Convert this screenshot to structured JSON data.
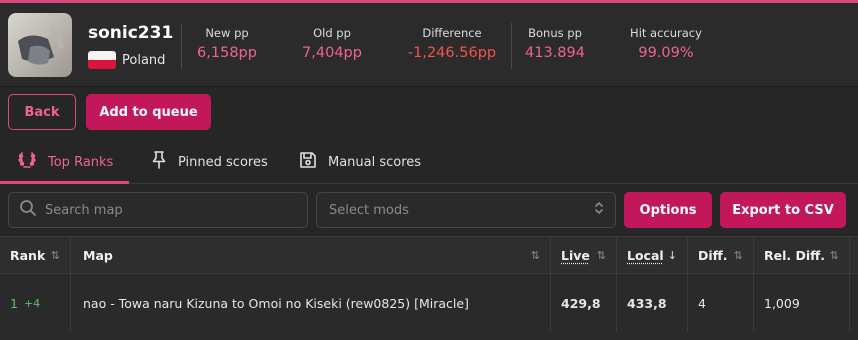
{
  "user": {
    "name": "sonic231",
    "country": "Poland"
  },
  "stats": [
    {
      "label": "New pp",
      "value": "6,158pp"
    },
    {
      "label": "Old pp",
      "value": "7,404pp"
    },
    {
      "label": "Difference",
      "value": "-1,246.56pp"
    },
    {
      "label": "Bonus pp",
      "value": "413.894"
    },
    {
      "label": "Hit accuracy",
      "value": "99.09%"
    }
  ],
  "actions": {
    "back": "Back",
    "add_to_queue": "Add to queue"
  },
  "tabs": [
    {
      "label": "Top Ranks",
      "icon": "laurel-icon",
      "active": true
    },
    {
      "label": "Pinned scores",
      "icon": "pin-icon",
      "active": false
    },
    {
      "label": "Manual scores",
      "icon": "save-icon",
      "active": false
    }
  ],
  "filters": {
    "search_placeholder": "Search map",
    "mods_placeholder": "Select mods",
    "options": "Options",
    "export": "Export to CSV"
  },
  "table": {
    "columns": [
      "Rank",
      "Map",
      "Live",
      "Local",
      "Diff.",
      "Rel. Diff."
    ],
    "rows": [
      {
        "rank": "1",
        "rank_change": "+4",
        "map": "nao - Towa naru Kizuna to Omoi no Kiseki (rew0825) [Miracle]",
        "live": "429,8",
        "local": "433,8",
        "diff": "4",
        "rel_diff": "1,009"
      }
    ]
  },
  "colors": {
    "accent": "#c2185b",
    "accent_text": "#f06292",
    "negative": "#ef5350",
    "positive": "#66bb6a",
    "background": "#262626"
  }
}
